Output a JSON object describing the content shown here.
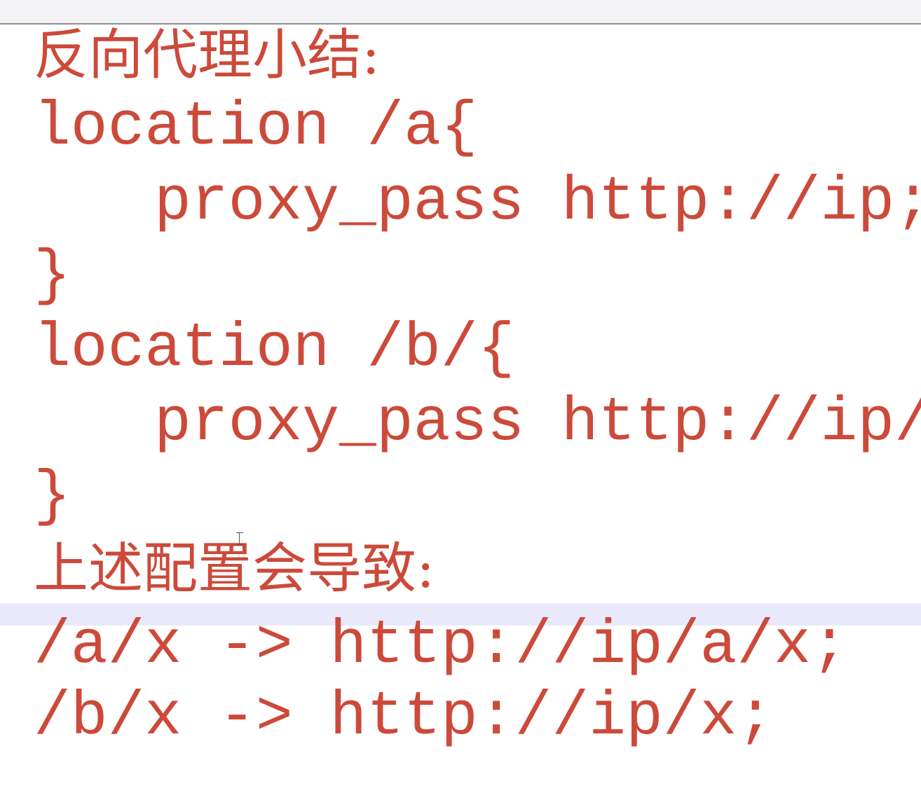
{
  "document": {
    "lines": [
      "反向代理小结:",
      "location /a{",
      "proxy_pass http://ip;",
      "}",
      "location /b/{",
      "proxy_pass http://ip/;",
      "}",
      "上述配置会导致:",
      "/a/x -> http://ip/a/x;",
      "/b/x -> http://ip/x;"
    ]
  },
  "colors": {
    "text": "#cc4a3a",
    "current_line_highlight": "#e9e9fb"
  }
}
